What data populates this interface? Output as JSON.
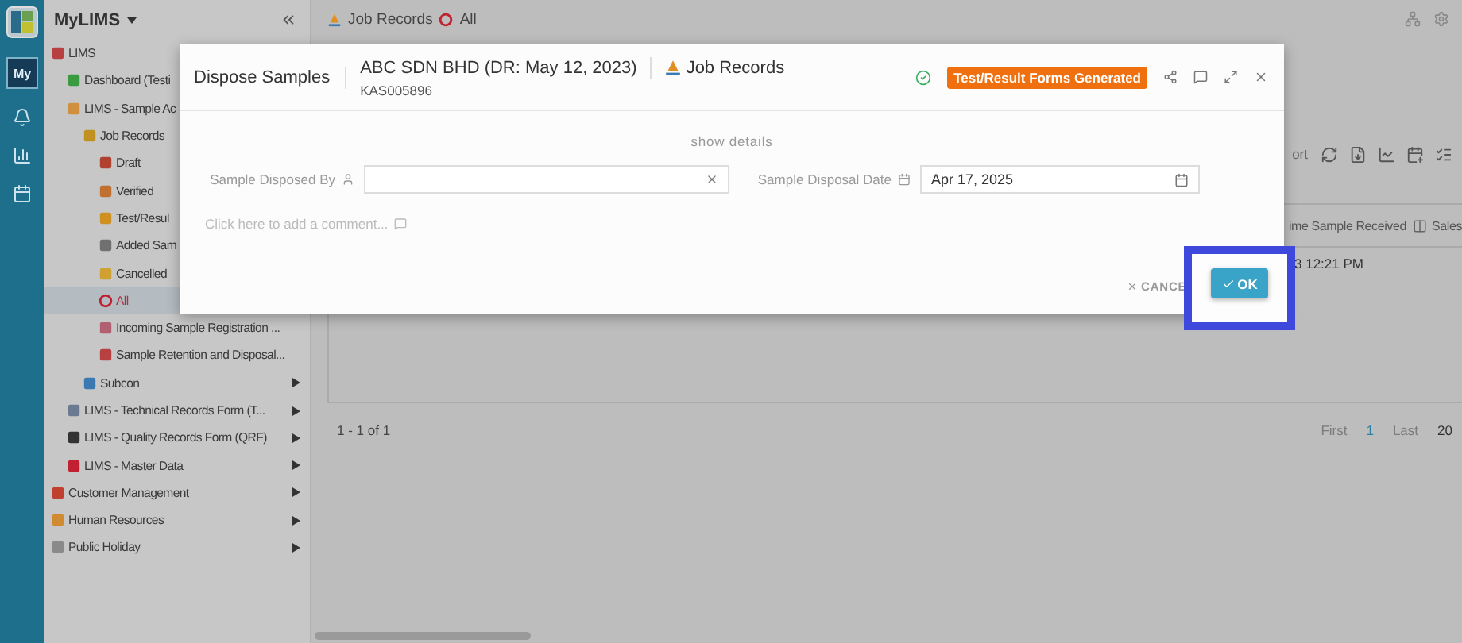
{
  "rail": {
    "avatar": "My"
  },
  "sidebar": {
    "title": "MyLIMS",
    "tree": [
      {
        "label": "LIMS",
        "selected": false,
        "expanded": true,
        "children": [
          {
            "label": "Dashboard (Testi",
            "selected": false
          },
          {
            "label": "LIMS - Sample Ac",
            "selected": false,
            "expanded": true,
            "children": [
              {
                "label": "Job Records",
                "selected": false,
                "expanded": true,
                "children": [
                  {
                    "label": "Draft",
                    "selected": false
                  },
                  {
                    "label": "Verified",
                    "selected": false
                  },
                  {
                    "label": "Test/Resul",
                    "selected": false
                  },
                  {
                    "label": "Added Sam",
                    "selected": false
                  },
                  {
                    "label": "Cancelled",
                    "selected": false
                  },
                  {
                    "label": "All",
                    "selected": true
                  },
                  {
                    "label": "Incoming Sample Registration ...",
                    "selected": false
                  },
                  {
                    "label": "Sample Retention and Disposal...",
                    "selected": false
                  }
                ]
              },
              {
                "label": "Subcon",
                "selected": false,
                "expanded": false
              }
            ]
          },
          {
            "label": "LIMS - Technical Records Form (T...",
            "selected": false,
            "expanded": false
          },
          {
            "label": "LIMS - Quality Records Form (QRF)",
            "selected": false,
            "expanded": false
          },
          {
            "label": "LIMS - Master Data",
            "selected": false,
            "expanded": false
          }
        ]
      },
      {
        "label": "Customer Management",
        "selected": false,
        "expanded": false
      },
      {
        "label": "Human Resources",
        "selected": false,
        "expanded": false
      },
      {
        "label": "Public Holiday",
        "selected": false,
        "expanded": false
      }
    ]
  },
  "breadcrumb": [
    {
      "label": "Job Records"
    },
    {
      "label": "All"
    }
  ],
  "toolbar": {
    "export_label": "ort"
  },
  "table": {
    "columns": [
      "ime Sample Received",
      "Sales"
    ],
    "rows": [
      {
        "cell": "3 12:21 PM"
      }
    ]
  },
  "footer": {
    "range": "1 - 1 of 1",
    "pages": [
      {
        "label": "First",
        "disabled": true,
        "selected": false
      },
      {
        "label": "1",
        "disabled": false,
        "selected": true
      },
      {
        "label": "Last",
        "disabled": true,
        "selected": false
      }
    ],
    "page_size": "20"
  },
  "dialog": {
    "title": "Dispose Samples",
    "record": "ABC SDN BHD (DR: May 12, 2023)",
    "code": "KAS005896",
    "module": "Job Records",
    "status": "Test/Result Forms Generated",
    "show_details": "show details",
    "fields": [
      {
        "label": "Sample Disposed By",
        "kind": "person"
      },
      {
        "label": "Sample Disposal Date",
        "kind": "date",
        "value": "Apr 17, 2025"
      }
    ],
    "comment_prompt": "Click here to add a comment...",
    "cancel": "CANCE",
    "ok": "OK"
  }
}
